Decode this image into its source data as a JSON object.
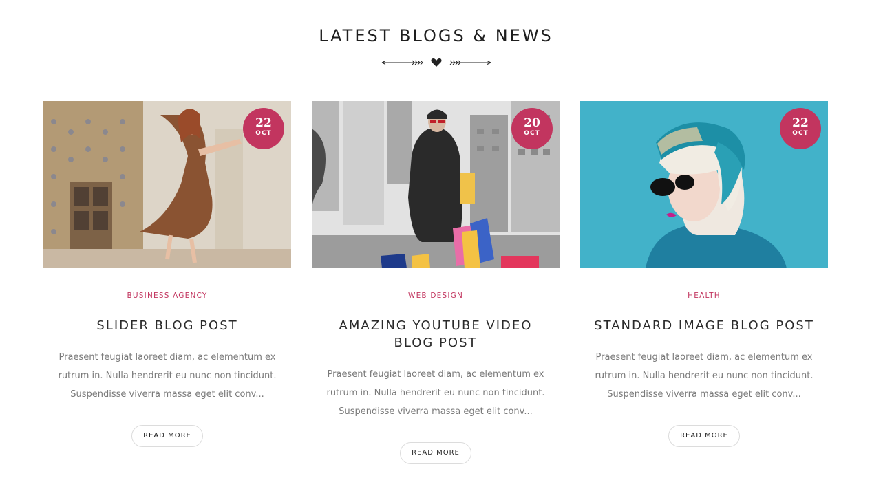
{
  "section": {
    "title": "LATEST BLOGS & NEWS"
  },
  "posts": [
    {
      "day": "22",
      "month": "OCT",
      "category": "BUSINESS AGENCY",
      "title": "SLIDER BLOG POST",
      "excerpt": "Praesent feugiat laoreet diam, ac elementum ex rutrum in. Nulla hendrerit eu nunc non tincidunt. Suspendisse viverra massa eget elit conv...",
      "button": "READ MORE"
    },
    {
      "day": "20",
      "month": "OCT",
      "category": "WEB DESIGN",
      "title": "AMAZING YOUTUBE VIDEO BLOG POST",
      "excerpt": "Praesent feugiat laoreet diam, ac elementum ex rutrum in. Nulla hendrerit eu nunc non tincidunt. Suspendisse viverra massa eget elit conv...",
      "button": "READ MORE"
    },
    {
      "day": "22",
      "month": "OCT",
      "category": "HEALTH",
      "title": "STANDARD IMAGE BLOG POST",
      "excerpt": "Praesent feugiat laoreet diam, ac elementum ex rutrum in. Nulla hendrerit eu nunc non tincidunt. Suspendisse viverra massa eget elit conv...",
      "button": "READ MORE"
    }
  ],
  "colors": {
    "accent": "#c2355f",
    "heading": "#1e1e1e",
    "body_text": "#7a7a7a",
    "button_border": "#dcdcdc"
  }
}
